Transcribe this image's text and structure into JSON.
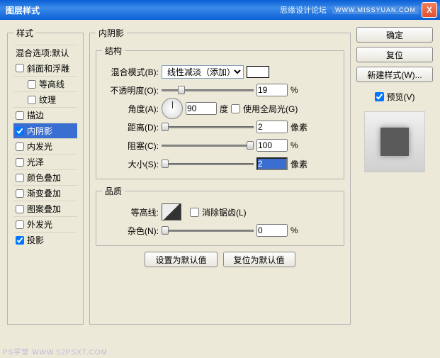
{
  "titlebar": {
    "title": "图层样式",
    "site": "思缘设计论坛",
    "url": "WWW.MISSYUAN.COM",
    "close": "X"
  },
  "sidebar": {
    "legend": "样式",
    "blend_opts": "混合选项:默认",
    "items": [
      {
        "label": "斜面和浮雕",
        "checked": false
      },
      {
        "label": "等高线",
        "checked": false,
        "indent": true
      },
      {
        "label": "纹理",
        "checked": false,
        "indent": true
      },
      {
        "label": "描边",
        "checked": false
      },
      {
        "label": "内阴影",
        "checked": true,
        "selected": true
      },
      {
        "label": "内发光",
        "checked": false
      },
      {
        "label": "光泽",
        "checked": false
      },
      {
        "label": "颜色叠加",
        "checked": false
      },
      {
        "label": "渐变叠加",
        "checked": false
      },
      {
        "label": "图案叠加",
        "checked": false
      },
      {
        "label": "外发光",
        "checked": false
      },
      {
        "label": "投影",
        "checked": true
      }
    ]
  },
  "panel": {
    "legend": "内阴影",
    "structure": {
      "legend": "结构",
      "blend_label": "混合模式(B):",
      "blend_value": "线性减淡（添加）",
      "opacity_label": "不透明度(O):",
      "opacity_value": "19",
      "pct": "%",
      "angle_label": "角度(A):",
      "angle_value": "90",
      "deg": "度",
      "global_label": "使用全局光(G)",
      "distance_label": "距离(D):",
      "distance_value": "2",
      "px": "像素",
      "spread_label": "阻塞(C):",
      "spread_value": "100",
      "size_label": "大小(S):",
      "size_value": "2"
    },
    "quality": {
      "legend": "品质",
      "contour_label": "等高线:",
      "antialias_label": "消除锯齿(L)",
      "noise_label": "杂色(N):",
      "noise_value": "0"
    },
    "btn_default": "设置为默认值",
    "btn_reset": "复位为默认值"
  },
  "right": {
    "ok": "确定",
    "reset": "复位",
    "newstyle": "新建样式(W)...",
    "preview": "预览(V)"
  },
  "watermark": "PS学堂   WWW.52PSXT.COM"
}
